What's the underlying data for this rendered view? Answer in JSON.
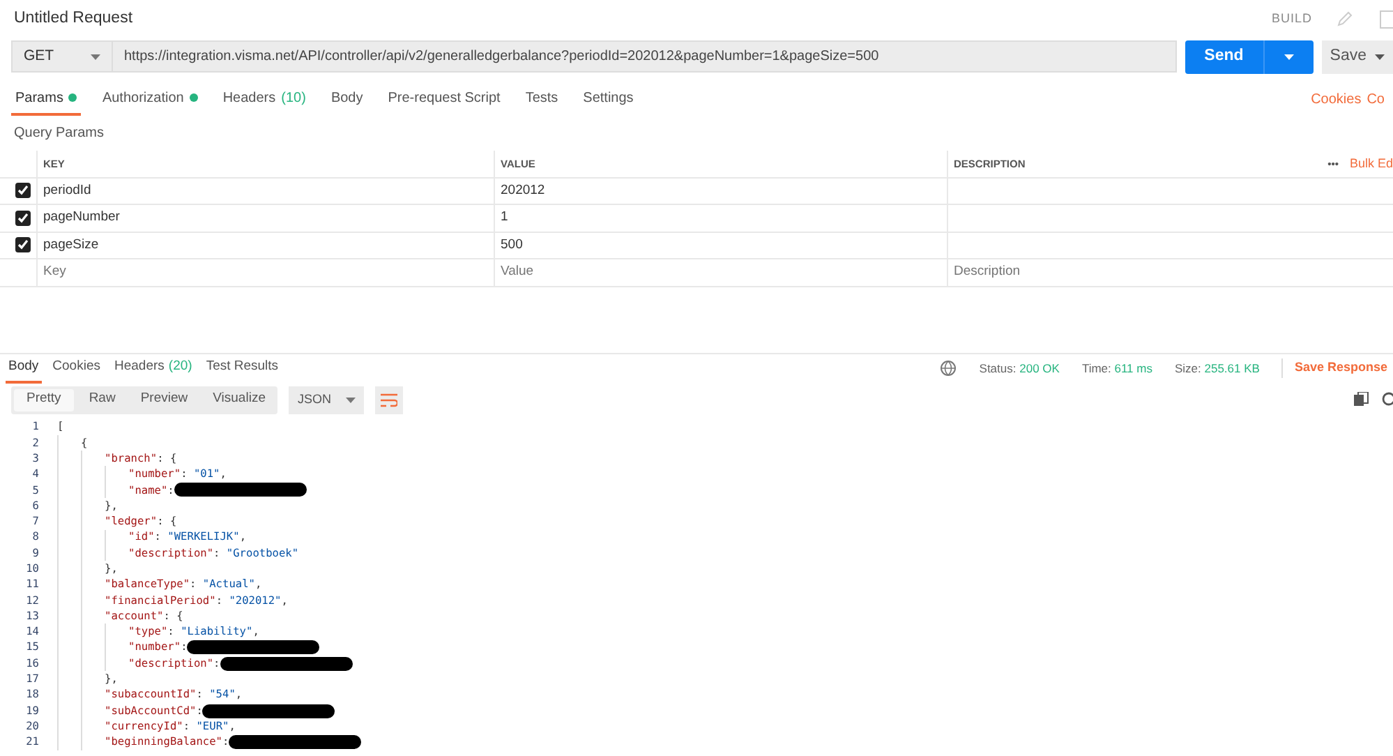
{
  "header": {
    "title": "Untitled Request",
    "build": "BUILD"
  },
  "request": {
    "method": "GET",
    "url": "https://integration.visma.net/API/controller/api/v2/generalledgerbalance?periodId=202012&pageNumber=1&pageSize=500",
    "send": "Send",
    "save": "Save"
  },
  "tabs": [
    {
      "label": "Params",
      "dot": true,
      "selected": true
    },
    {
      "label": "Authorization",
      "dot": true,
      "selected": false
    },
    {
      "label": "Headers",
      "dot": false,
      "count": "(10)",
      "selected": false
    },
    {
      "label": "Body",
      "dot": false,
      "selected": false
    },
    {
      "label": "Pre-request Script",
      "dot": false,
      "selected": false
    },
    {
      "label": "Tests",
      "dot": false,
      "selected": false
    },
    {
      "label": "Settings",
      "dot": false,
      "selected": false
    }
  ],
  "tab_links": [
    "Cookies",
    "Co"
  ],
  "params": {
    "title": "Query Params",
    "columns": [
      "KEY",
      "VALUE",
      "DESCRIPTION"
    ],
    "more": "•••",
    "bulk_edit": "Bulk Ed",
    "rows": [
      {
        "key": "periodId",
        "value": "202012",
        "checked": true
      },
      {
        "key": "pageNumber",
        "value": "1",
        "checked": true
      },
      {
        "key": "pageSize",
        "value": "500",
        "checked": true
      }
    ],
    "new_row": [
      {
        "placeholder": "Key"
      },
      {
        "placeholder": "Value"
      },
      {
        "placeholder": "Description"
      }
    ]
  },
  "response_tabs": [
    {
      "label": "Body",
      "selected": true
    },
    {
      "label": "Cookies",
      "selected": false
    },
    {
      "label": "Headers",
      "count": "(20)",
      "selected": false
    },
    {
      "label": "Test Results",
      "selected": false
    }
  ],
  "response_meta": [
    {
      "label": "Status:",
      "value": "200 OK"
    },
    {
      "label": "Time:",
      "value": "611 ms"
    },
    {
      "label": "Size:",
      "value": "255.61 KB"
    }
  ],
  "save_response": "Save Response",
  "view_modes": [
    {
      "label": "Pretty",
      "selected": true
    },
    {
      "label": "Raw",
      "selected": false
    },
    {
      "label": "Preview",
      "selected": false
    },
    {
      "label": "Visualize",
      "selected": false
    }
  ],
  "format": "JSON",
  "code": [
    {
      "number": "1",
      "tokens": [
        {
          "kind": "punct",
          "text": "["
        }
      ],
      "children": [
        {
          "number": "2",
          "tokens": [
            {
              "kind": "punct",
              "text": "{"
            }
          ],
          "children": [
            {
              "number": "3",
              "tokens": [
                {
                  "kind": "key",
                  "text": "\"branch\""
                },
                {
                  "kind": "punct",
                  "text": ": {"
                }
              ],
              "children": [
                {
                  "number": "4",
                  "tokens": [
                    {
                      "kind": "key",
                      "text": "\"number\""
                    },
                    {
                      "kind": "punct",
                      "text": ": "
                    },
                    {
                      "kind": "string",
                      "text": "\"01\""
                    },
                    {
                      "kind": "punct",
                      "text": ","
                    }
                  ]
                },
                {
                  "number": "5",
                  "tokens": [
                    {
                      "kind": "key",
                      "text": "\"name\""
                    },
                    {
                      "kind": "punct",
                      "text": ":"
                    },
                    {
                      "kind": "redaction"
                    }
                  ]
                }
              ]
            },
            {
              "number": "6",
              "tokens": [
                {
                  "kind": "punct",
                  "text": "},"
                }
              ]
            },
            {
              "number": "7",
              "tokens": [
                {
                  "kind": "key",
                  "text": "\"ledger\""
                },
                {
                  "kind": "punct",
                  "text": ": {"
                }
              ],
              "children": [
                {
                  "number": "8",
                  "tokens": [
                    {
                      "kind": "key",
                      "text": "\"id\""
                    },
                    {
                      "kind": "punct",
                      "text": ": "
                    },
                    {
                      "kind": "string",
                      "text": "\"WERKELIJK\""
                    },
                    {
                      "kind": "punct",
                      "text": ","
                    }
                  ]
                },
                {
                  "number": "9",
                  "tokens": [
                    {
                      "kind": "key",
                      "text": "\"description\""
                    },
                    {
                      "kind": "punct",
                      "text": ": "
                    },
                    {
                      "kind": "string",
                      "text": "\"Grootboek\""
                    }
                  ]
                }
              ]
            },
            {
              "number": "10",
              "tokens": [
                {
                  "kind": "punct",
                  "text": "},"
                }
              ]
            },
            {
              "number": "11",
              "tokens": [
                {
                  "kind": "key",
                  "text": "\"balanceType\""
                },
                {
                  "kind": "punct",
                  "text": ": "
                },
                {
                  "kind": "string",
                  "text": "\"Actual\""
                },
                {
                  "kind": "punct",
                  "text": ","
                }
              ]
            },
            {
              "number": "12",
              "tokens": [
                {
                  "kind": "key",
                  "text": "\"financialPeriod\""
                },
                {
                  "kind": "punct",
                  "text": ": "
                },
                {
                  "kind": "string",
                  "text": "\"202012\""
                },
                {
                  "kind": "punct",
                  "text": ","
                }
              ]
            },
            {
              "number": "13",
              "tokens": [
                {
                  "kind": "key",
                  "text": "\"account\""
                },
                {
                  "kind": "punct",
                  "text": ": {"
                }
              ],
              "children": [
                {
                  "number": "14",
                  "tokens": [
                    {
                      "kind": "key",
                      "text": "\"type\""
                    },
                    {
                      "kind": "punct",
                      "text": ": "
                    },
                    {
                      "kind": "string",
                      "text": "\"Liability\""
                    },
                    {
                      "kind": "punct",
                      "text": ","
                    }
                  ]
                },
                {
                  "number": "15",
                  "tokens": [
                    {
                      "kind": "key",
                      "text": "\"number\""
                    },
                    {
                      "kind": "punct",
                      "text": ":"
                    },
                    {
                      "kind": "redaction"
                    }
                  ]
                },
                {
                  "number": "16",
                  "tokens": [
                    {
                      "kind": "key",
                      "text": "\"description\""
                    },
                    {
                      "kind": "punct",
                      "text": ":"
                    },
                    {
                      "kind": "redaction"
                    }
                  ]
                }
              ]
            },
            {
              "number": "17",
              "tokens": [
                {
                  "kind": "punct",
                  "text": "},"
                }
              ]
            },
            {
              "number": "18",
              "tokens": [
                {
                  "kind": "key",
                  "text": "\"subaccountId\""
                },
                {
                  "kind": "punct",
                  "text": ": "
                },
                {
                  "kind": "string",
                  "text": "\"54\""
                },
                {
                  "kind": "punct",
                  "text": ","
                }
              ]
            },
            {
              "number": "19",
              "tokens": [
                {
                  "kind": "key",
                  "text": "\"subAccountCd\""
                },
                {
                  "kind": "punct",
                  "text": ":"
                },
                {
                  "kind": "redaction"
                }
              ]
            },
            {
              "number": "20",
              "tokens": [
                {
                  "kind": "key",
                  "text": "\"currencyId\""
                },
                {
                  "kind": "punct",
                  "text": ": "
                },
                {
                  "kind": "string",
                  "text": "\"EUR\""
                },
                {
                  "kind": "punct",
                  "text": ","
                }
              ]
            },
            {
              "number": "21",
              "tokens": [
                {
                  "kind": "key",
                  "text": "\"beginningBalance\""
                },
                {
                  "kind": "punct",
                  "text": ":"
                },
                {
                  "kind": "redaction"
                }
              ]
            }
          ]
        }
      ]
    }
  ]
}
